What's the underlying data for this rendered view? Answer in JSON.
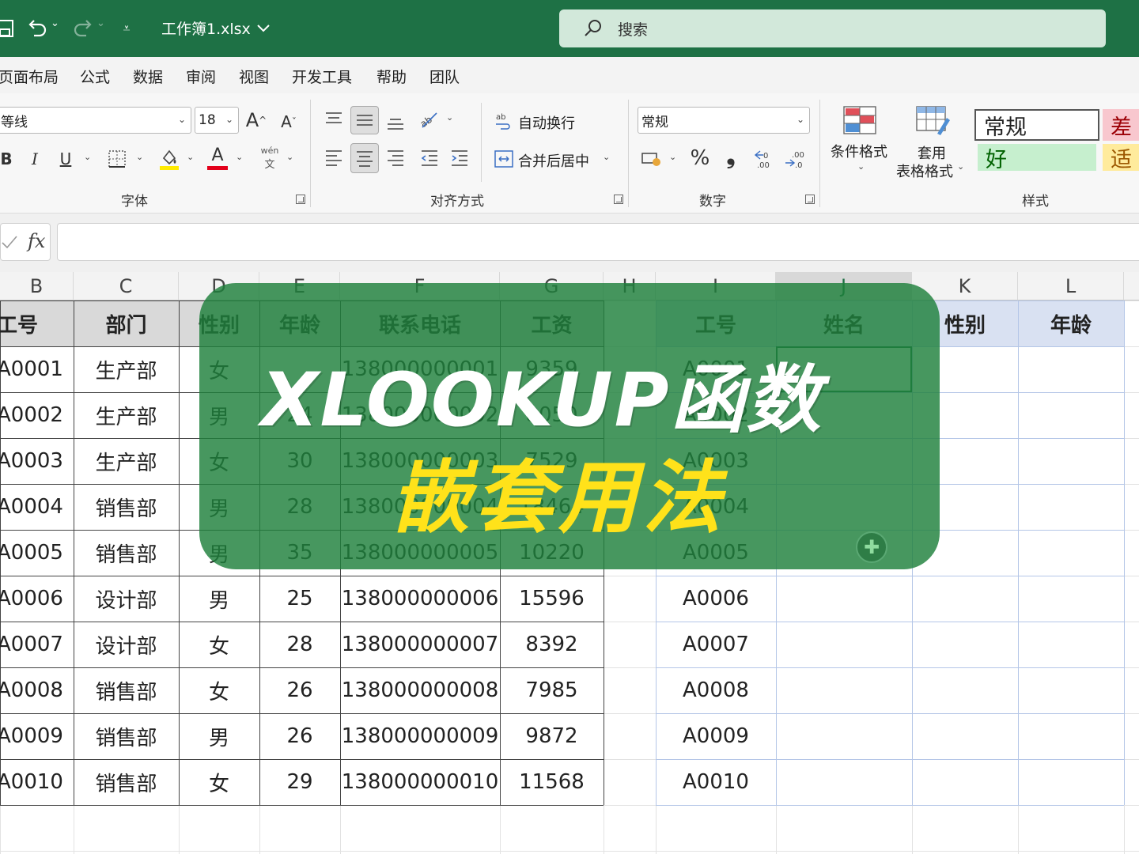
{
  "titlebar": {
    "doc_title": "工作簿1.xlsx",
    "search_text": "搜索",
    "accent": "#1e7145"
  },
  "menu": [
    "页面布局",
    "公式",
    "数据",
    "审阅",
    "视图",
    "开发工具",
    "帮助",
    "团队"
  ],
  "ribbon": {
    "font_name": "等线",
    "font_size": "18",
    "bold": "B",
    "italic": "I",
    "underline": "U",
    "font_color_letter": "A",
    "phonetic_top": "wén",
    "phonetic_bottom": "文",
    "wrap_text": "自动换行",
    "merge_center": "合并后居中",
    "number_format": "常规",
    "percent": "%",
    "comma": "❟",
    "conditional_format": "条件格式",
    "table_format_1": "套用",
    "table_format_2": "表格格式",
    "style_normal": "常规",
    "style_bad": "差",
    "style_good": "好",
    "style_neutral": "适",
    "groups": {
      "font": "字体",
      "align": "对齐方式",
      "number": "数字",
      "styles": "样式"
    }
  },
  "formula_bar": {
    "fx": "fx",
    "value": ""
  },
  "columns": [
    "B",
    "C",
    "D",
    "E",
    "F",
    "G",
    "H",
    "I",
    "J",
    "K",
    "L"
  ],
  "left_table": {
    "headers": [
      "工号",
      "部门",
      "性别",
      "年龄",
      "联系电话",
      "工资"
    ],
    "rows": [
      [
        "A0001",
        "生产部",
        "女",
        "",
        "138000000001",
        "9359"
      ],
      [
        "A0002",
        "生产部",
        "男",
        "24",
        "138000000002",
        "8050"
      ],
      [
        "A0003",
        "生产部",
        "女",
        "30",
        "138000000003",
        "7529"
      ],
      [
        "A0004",
        "销售部",
        "男",
        "28",
        "138000000004",
        "18464"
      ],
      [
        "A0005",
        "销售部",
        "男",
        "35",
        "138000000005",
        "10220"
      ],
      [
        "A0006",
        "设计部",
        "男",
        "25",
        "138000000006",
        "15596"
      ],
      [
        "A0007",
        "设计部",
        "女",
        "28",
        "138000000007",
        "8392"
      ],
      [
        "A0008",
        "销售部",
        "女",
        "26",
        "138000000008",
        "7985"
      ],
      [
        "A0009",
        "销售部",
        "男",
        "26",
        "138000000009",
        "9872"
      ],
      [
        "A0010",
        "销售部",
        "女",
        "29",
        "138000000010",
        "11568"
      ]
    ]
  },
  "right_table": {
    "headers": [
      "工号",
      "姓名",
      "性别",
      "年龄"
    ],
    "ids": [
      "A0001",
      "A0002",
      "A0003",
      "A0004",
      "A0005",
      "A0006",
      "A0007",
      "A0008",
      "A0009",
      "A0010"
    ]
  },
  "overlay": {
    "title": "XLOOKUP函数",
    "subtitle": "嵌套用法",
    "bg": "#1e803c",
    "subtitle_color": "#ffe21a"
  }
}
